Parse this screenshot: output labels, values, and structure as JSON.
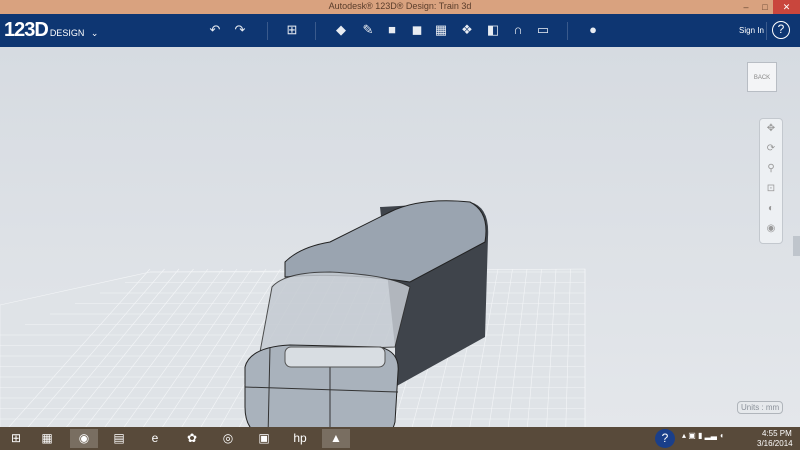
{
  "window": {
    "title": "Autodesk® 123D® Design: Train 3d",
    "minimize": "–",
    "maximize": "□",
    "close": "✕"
  },
  "toolbar": {
    "logo": "123D",
    "logo_sub": "DESIGN",
    "logo_menu": "⌄",
    "sign_in": "Sign In",
    "help": "?",
    "tools": [
      {
        "name": "undo-icon",
        "g": "↶"
      },
      {
        "name": "redo-icon",
        "g": "↷"
      },
      {
        "name": "transform-icon",
        "g": "⊞"
      },
      {
        "name": "primitives-icon",
        "g": "◆"
      },
      {
        "name": "sketch-icon",
        "g": "✎"
      },
      {
        "name": "construct-icon",
        "g": "■"
      },
      {
        "name": "modify-icon",
        "g": "◼"
      },
      {
        "name": "pattern-icon",
        "g": "▦"
      },
      {
        "name": "grouping-icon",
        "g": "❖"
      },
      {
        "name": "combine-icon",
        "g": "◧"
      },
      {
        "name": "snap-icon",
        "g": "∩"
      },
      {
        "name": "measure-icon",
        "g": "▭"
      },
      {
        "name": "material-icon",
        "g": "●"
      }
    ]
  },
  "viewcube": {
    "label": "BACK"
  },
  "nav_tools": [
    {
      "name": "pan-icon",
      "g": "✥"
    },
    {
      "name": "orbit-icon",
      "g": "⟳"
    },
    {
      "name": "zoom-icon",
      "g": "⚲"
    },
    {
      "name": "fit-icon",
      "g": "⊡"
    },
    {
      "name": "view-mode-icon",
      "g": "◐"
    },
    {
      "name": "visibility-icon",
      "g": "◉"
    }
  ],
  "units": "Units : mm",
  "taskbar": {
    "time": "4:55 PM",
    "date": "3/16/2014",
    "apps": [
      {
        "name": "start-icon",
        "g": "⊞"
      },
      {
        "name": "apps-icon",
        "g": "▦"
      },
      {
        "name": "chrome-icon",
        "g": "◉"
      },
      {
        "name": "file-explorer-icon",
        "g": "▤"
      },
      {
        "name": "ie-icon",
        "g": "e"
      },
      {
        "name": "photos-icon",
        "g": "✿"
      },
      {
        "name": "media-icon",
        "g": "◎"
      },
      {
        "name": "presentation-icon",
        "g": "▣"
      },
      {
        "name": "hp-icon",
        "g": "hp"
      },
      {
        "name": "123d-icon",
        "g": "▲"
      }
    ],
    "help": "?"
  }
}
